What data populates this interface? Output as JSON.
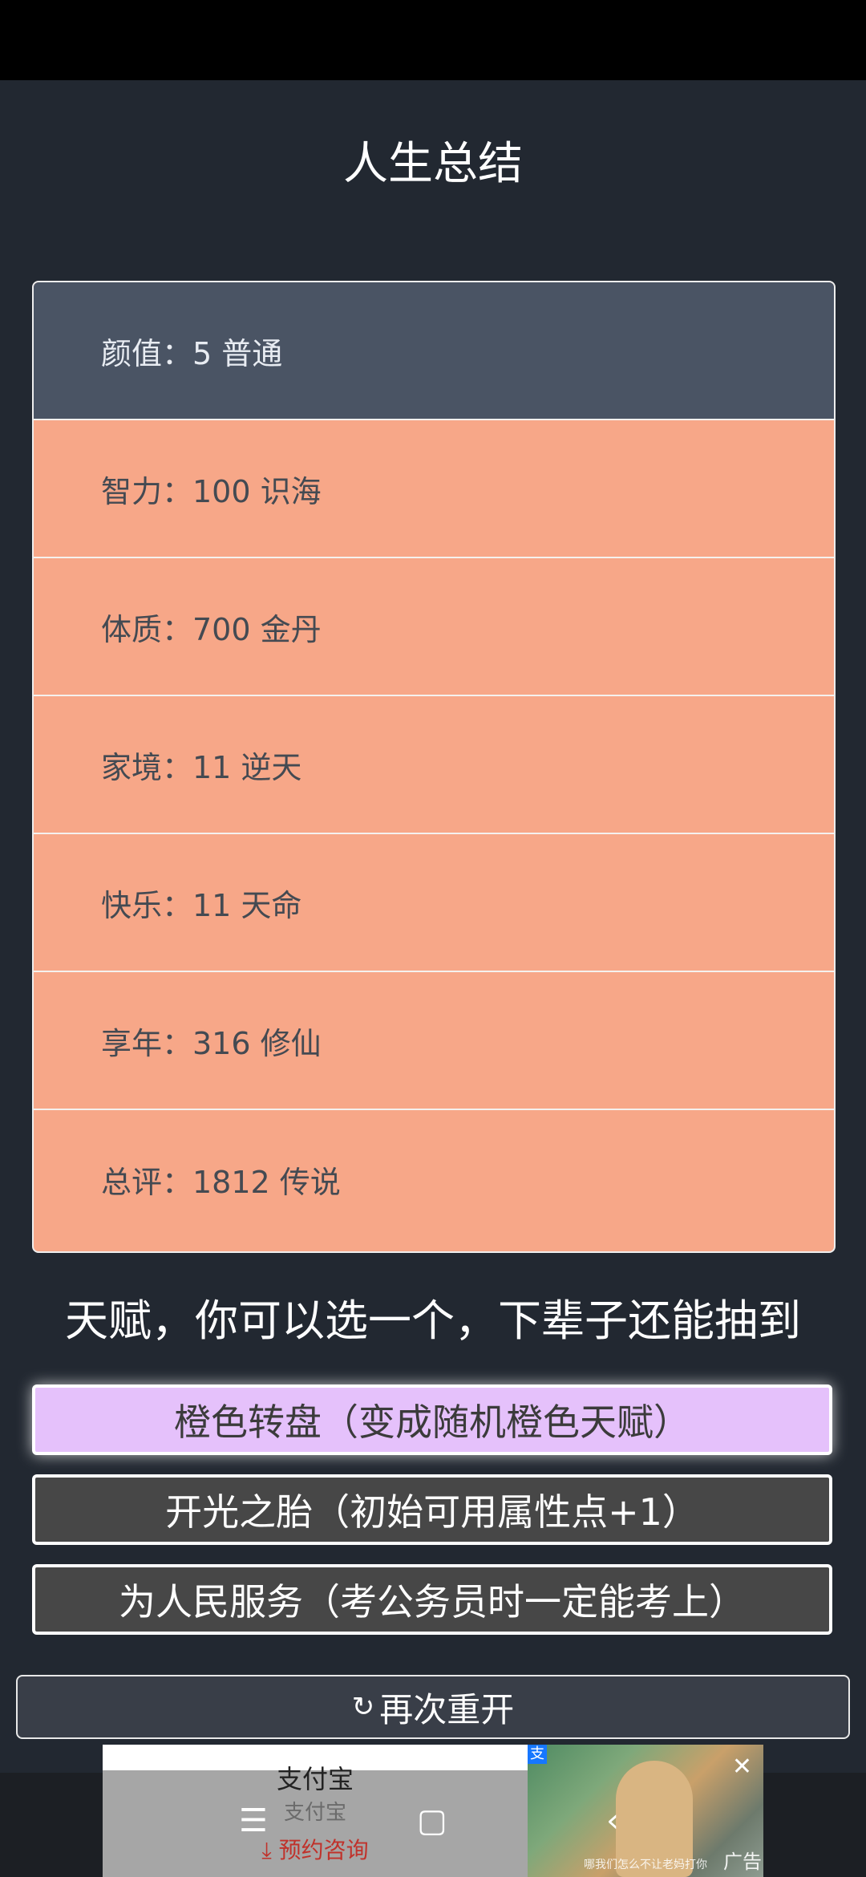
{
  "header": {
    "title": "人生总结"
  },
  "summary": [
    {
      "label": "颜值：5 普通"
    },
    {
      "label": "智力：100 识海"
    },
    {
      "label": "体质：700 金丹"
    },
    {
      "label": "家境：11 逆天"
    },
    {
      "label": "快乐：11 天命"
    },
    {
      "label": "享年：316 修仙"
    },
    {
      "label": "总评：1812 传说"
    }
  ],
  "talents": {
    "heading": "天赋，你可以选一个，下辈子还能抽到",
    "options": [
      {
        "label": "橙色转盘（变成随机橙色天赋）",
        "selected": true
      },
      {
        "label": "开光之胎（初始可用属性点+1）",
        "selected": false
      },
      {
        "label": "为人民服务（考公务员时一定能考上）",
        "selected": false
      }
    ]
  },
  "restart": {
    "label": "再次重开",
    "icon": "refresh-icon"
  },
  "ad": {
    "title": "支付宝",
    "subtitle": "支付宝",
    "cta": "预约咨询",
    "label": "广告",
    "badge": "支",
    "caption": "哪我们怎么不让老妈打你"
  },
  "navigation": {
    "menu": "menu-icon",
    "home": "home-icon",
    "back": "back-icon"
  }
}
